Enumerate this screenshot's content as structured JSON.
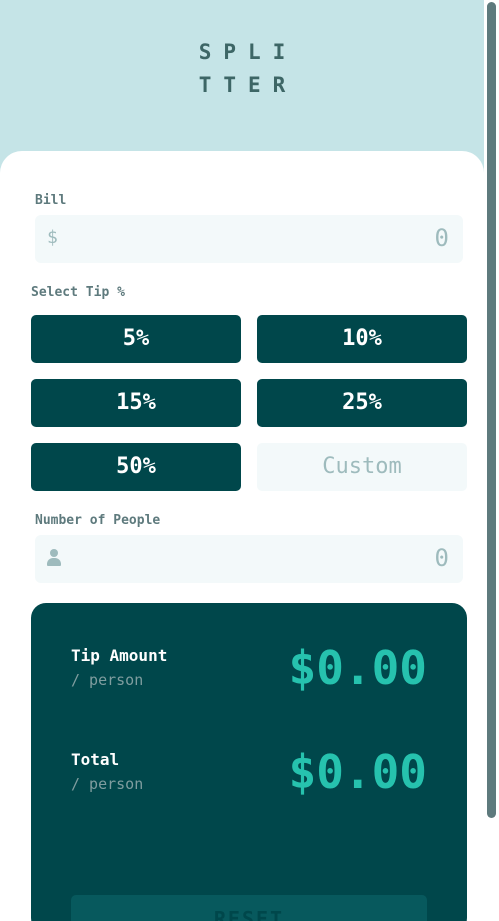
{
  "logo": {
    "line1": "SPLI",
    "line2": "TTER"
  },
  "bill": {
    "label": "Bill",
    "prefix": "$",
    "value": "0"
  },
  "tip": {
    "label": "Select Tip %",
    "options": [
      "5%",
      "10%",
      "15%",
      "25%",
      "50%"
    ],
    "custom_placeholder": "Custom"
  },
  "people": {
    "label": "Number of People",
    "value": "0"
  },
  "results": {
    "tip_amount_label": "Tip Amount",
    "tip_amount_sub": "/ person",
    "tip_amount_value": "$0.00",
    "total_label": "Total",
    "total_sub": "/ person",
    "total_value": "$0.00",
    "reset_label": "RESET"
  },
  "colors": {
    "background": "#c5e4e7",
    "dark_cyan": "#00474b",
    "strong_cyan": "#26c2ae",
    "input_bg": "#f3f9fa"
  }
}
